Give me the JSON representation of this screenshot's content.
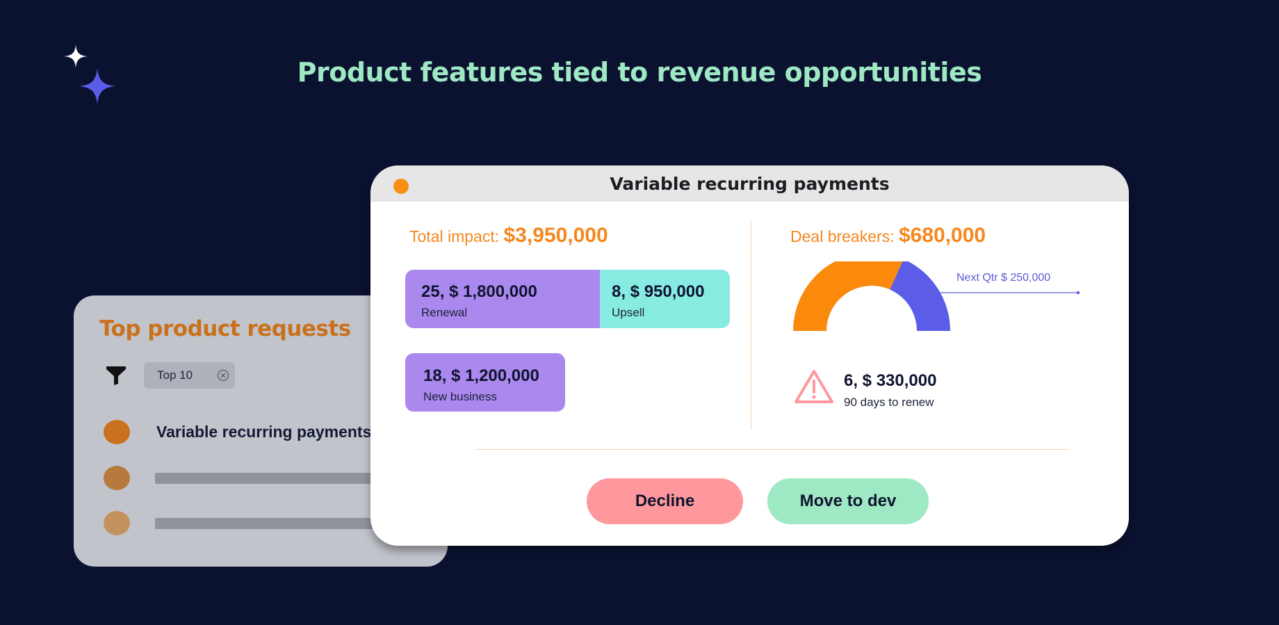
{
  "headline": "Product features tied to revenue opportunities",
  "top_requests": {
    "title": "Top product requests",
    "filter_chip": "Top 10",
    "items": [
      {
        "label": "Variable recurring payments",
        "color": "#c9711c"
      },
      {
        "label": "",
        "color": "#b77a3c"
      },
      {
        "label": "",
        "color": "#c3915e"
      }
    ]
  },
  "card": {
    "title": "Variable recurring payments",
    "total_impact": {
      "label": "Total impact:",
      "value": "$3,950,000"
    },
    "segments": {
      "renewal": {
        "value": "25,  $ 1,800,000",
        "label": "Renewal",
        "color": "#ab88ee"
      },
      "upsell": {
        "value": "8,  $ 950,000",
        "label": "Upsell",
        "color": "#87ebe2"
      },
      "new_business": {
        "value": "18,  $ 1,200,000",
        "label": "New business",
        "color": "#ab88ee"
      }
    },
    "deal_breakers": {
      "label": "Deal breakers:",
      "value": "$680,000"
    },
    "gauge": {
      "current_fraction": 0.633,
      "current_color": "#fb8a0c",
      "next_color": "#5b5ce8"
    },
    "next_qtr": "Next Qtr $ 250,000",
    "risk": {
      "value": "6,  $ 330,000",
      "label": "90 days to renew"
    },
    "buttons": {
      "decline": "Decline",
      "move": "Move to dev"
    }
  }
}
